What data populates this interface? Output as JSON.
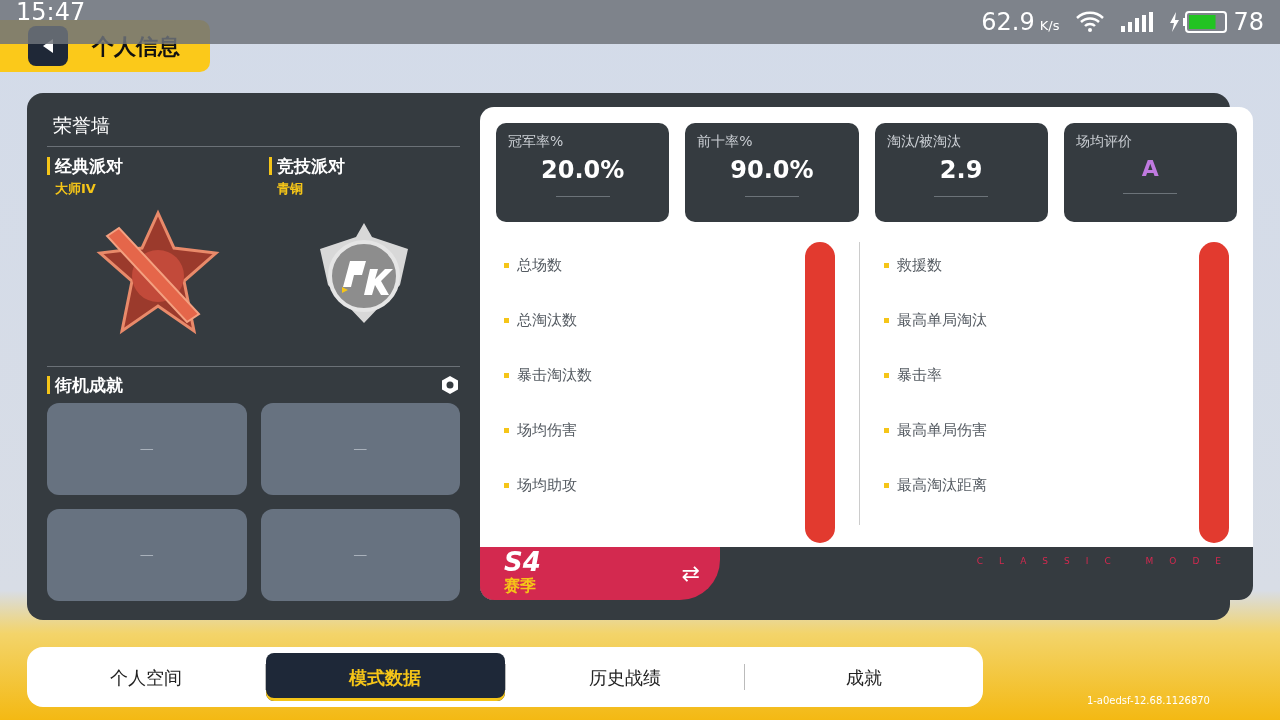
{
  "status_bar": {
    "time": "15:47",
    "speed": "62.9",
    "speed_unit": "K/s",
    "battery": {
      "level": 0.78,
      "charging": true,
      "reading": "78"
    }
  },
  "header": {
    "title": "个人信息"
  },
  "honor_wall": {
    "title": "荣誉墙",
    "modes": [
      {
        "name": "经典派对",
        "rank": "大师IV",
        "kind": "rifle"
      },
      {
        "name": "竞技派对",
        "rank": "青铜",
        "kind": "pk"
      }
    ]
  },
  "arcade": {
    "title": "街机成就",
    "slots": [
      "—",
      "—",
      "—",
      "—"
    ]
  },
  "summary": [
    {
      "label": "冠军率%",
      "value": "20.0%",
      "kind": "number"
    },
    {
      "label": "前十率%",
      "value": "90.0%",
      "kind": "number"
    },
    {
      "label": "淘汰/被淘汰",
      "value": "2.9",
      "kind": "number"
    },
    {
      "label": "场均评价",
      "value": "A",
      "kind": "grade"
    }
  ],
  "stats_left": [
    "总场数",
    "总淘汰数",
    "暴击淘汰数",
    "场均伤害",
    "场均助攻"
  ],
  "stats_right": [
    "救援数",
    "最高单局淘汰",
    "暴击率",
    "最高单局伤害",
    "最高淘汰距离"
  ],
  "season": {
    "code": "S4",
    "label": "赛季",
    "swap": "⇄",
    "mode_caption": "CLASSIC MODE"
  },
  "tabs": [
    {
      "label": "个人空间",
      "selected": false
    },
    {
      "label": "模式数据",
      "selected": true
    },
    {
      "label": "历史战绩",
      "selected": false
    },
    {
      "label": "成就",
      "selected": false
    }
  ],
  "version": "1-a0edsf-12.68.1126870"
}
